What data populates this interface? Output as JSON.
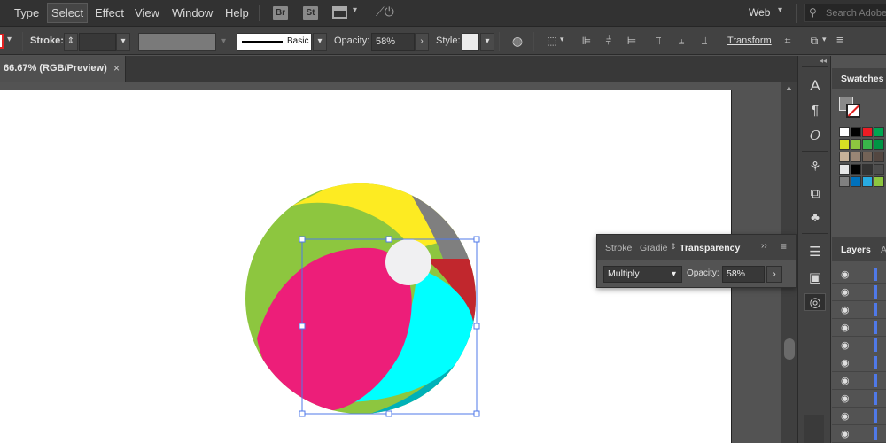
{
  "menu": {
    "items": [
      "Type",
      "Select",
      "Effect",
      "View",
      "Window",
      "Help"
    ],
    "bridge_label": "Br",
    "stock_label": "St",
    "workspace": "Web",
    "search_placeholder": "Search Adobe"
  },
  "control_bar": {
    "stroke_label": "Stroke:",
    "brush_label": "Basic",
    "opacity_label": "Opacity:",
    "opacity_value": "58%",
    "style_label": "Style:",
    "transform_label": "Transform"
  },
  "document": {
    "tab_label": "66.67% (RGB/Preview)",
    "close_glyph": "×"
  },
  "transparency_panel": {
    "tabs": [
      "Stroke",
      "Gradie",
      "Transparency"
    ],
    "active_tab": "Transparency",
    "blend_mode": "Multiply",
    "opacity_label": "Opacity:",
    "opacity_value": "58%"
  },
  "swatches_panel": {
    "title": "Swatches",
    "colors": [
      [
        "#ffffff",
        "#000000",
        "#ed1c24",
        "#00a651"
      ],
      [
        "#d7df23",
        "#8dc63f",
        "#39b54a",
        "#009444"
      ],
      [
        "#c7b299",
        "#998675",
        "#736357",
        "#534741"
      ],
      [
        "#e6e6e6",
        "#000000",
        "#333333",
        "#4d4d4d"
      ],
      [
        "#808080",
        "#0071bc",
        "#29abe2",
        "#8dc63f"
      ]
    ]
  },
  "layers_panel": {
    "title": "Layers",
    "partial_tab": "A",
    "row_count": 10
  },
  "colors": {
    "yellow": "#fdeb22",
    "gray": "#7f7f7f",
    "green": "#8dc63f",
    "pink": "#ed1e79",
    "cyan": "#00ffff",
    "teal": "#00b1b8",
    "red": "#c1272d",
    "highlight": "#f0f0f2",
    "selection": "#4f79e8"
  }
}
